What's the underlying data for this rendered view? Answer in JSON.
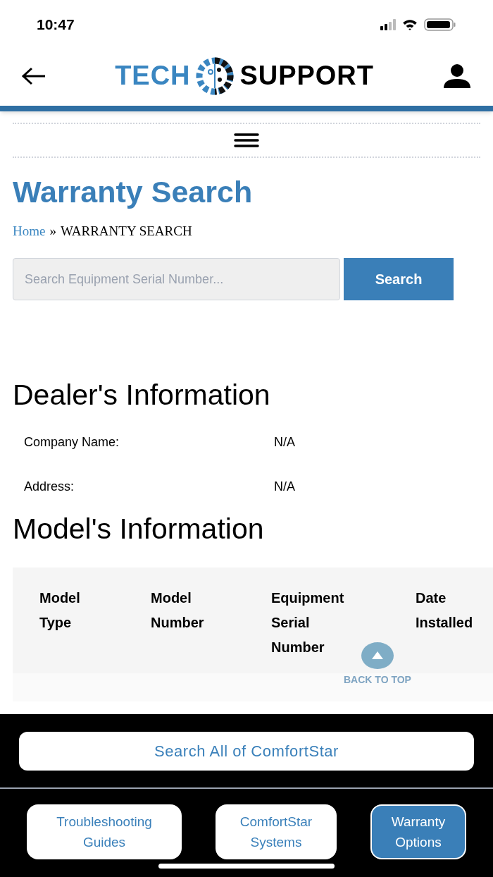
{
  "status_bar": {
    "time": "10:47"
  },
  "header": {
    "logo_left": "TECH",
    "logo_right": "SUPPORT"
  },
  "page": {
    "title": "Warranty Search",
    "breadcrumb": {
      "home": "Home",
      "separator": "»",
      "current": "WARRANTY SEARCH"
    }
  },
  "search": {
    "placeholder": "Search Equipment Serial Number...",
    "button": "Search"
  },
  "dealer": {
    "title": "Dealer's Information",
    "fields": [
      {
        "label": "Company Name:",
        "value": "N/A"
      },
      {
        "label": "Address:",
        "value": "N/A"
      }
    ]
  },
  "model": {
    "title": "Model's Information",
    "columns": [
      "Model Type",
      "Model Number",
      "Equipment Serial Number",
      "Date Installed"
    ]
  },
  "back_to_top": "BACK TO TOP",
  "search_all": "Search All of ComfortStar",
  "nav": [
    {
      "label": "Troubleshooting Guides",
      "selected": false
    },
    {
      "label": "ComfortStar Systems",
      "selected": false
    },
    {
      "label": "Warranty Options",
      "selected": true
    }
  ]
}
